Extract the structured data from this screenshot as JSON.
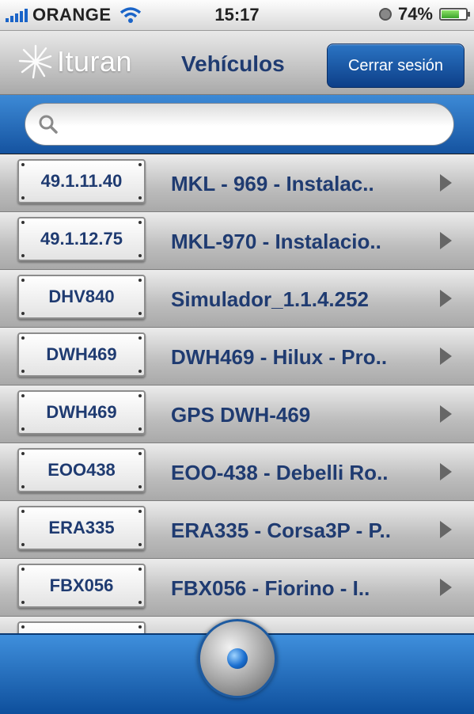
{
  "status_bar": {
    "carrier": "ORANGE",
    "time": "15:17",
    "battery": "74%",
    "battery_level": 0.74
  },
  "header": {
    "logo_text": "Ituran",
    "title": "Vehículos",
    "logout_label": "Cerrar sesión"
  },
  "search": {
    "placeholder": "",
    "value": ""
  },
  "vehicles": [
    {
      "plate": "49.1.11.40",
      "description": "MKL - 969 - Instalac.."
    },
    {
      "plate": "49.1.12.75",
      "description": "MKL-970 - Instalacio.."
    },
    {
      "plate": "DHV840",
      "description": "Simulador_1.1.4.252"
    },
    {
      "plate": "DWH469",
      "description": "DWH469 - Hilux - Pro.."
    },
    {
      "plate": "DWH469",
      "description": "GPS DWH-469"
    },
    {
      "plate": "EOO438",
      "description": "EOO-438 - Debelli Ro.."
    },
    {
      "plate": "ERA335",
      "description": "ERA335 - Corsa3P - P.."
    },
    {
      "plate": "FBX056",
      "description": "FBX056 - Fiorino - I.."
    },
    {
      "plate": "",
      "description": ""
    }
  ],
  "colors": {
    "brand_blue": "#1f3b71",
    "bar_blue": "#1553a0"
  }
}
